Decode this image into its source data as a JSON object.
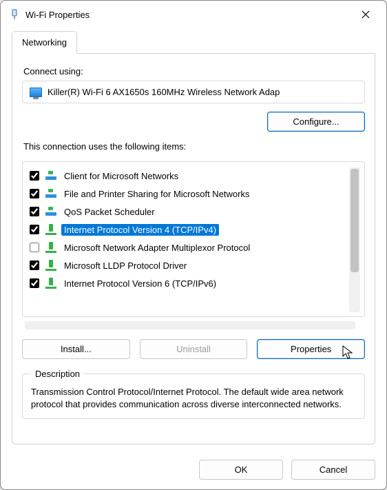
{
  "window": {
    "title": "Wi-Fi Properties"
  },
  "tabs": {
    "networking": "Networking"
  },
  "connect_label": "Connect using:",
  "adapter": "Killer(R) Wi-Fi 6 AX1650s 160MHz Wireless Network Adap",
  "configure_btn": "Configure...",
  "items_label": "This connection uses the following items:",
  "items": [
    {
      "checked": true,
      "icon": "client",
      "name": "Client for Microsoft Networks",
      "selected": false
    },
    {
      "checked": true,
      "icon": "client",
      "name": "File and Printer Sharing for Microsoft Networks",
      "selected": false
    },
    {
      "checked": true,
      "icon": "client",
      "name": "QoS Packet Scheduler",
      "selected": false
    },
    {
      "checked": true,
      "icon": "proto",
      "name": "Internet Protocol Version 4 (TCP/IPv4)",
      "selected": true
    },
    {
      "checked": false,
      "icon": "proto",
      "name": "Microsoft Network Adapter Multiplexor Protocol",
      "selected": false
    },
    {
      "checked": true,
      "icon": "proto",
      "name": "Microsoft LLDP Protocol Driver",
      "selected": false
    },
    {
      "checked": true,
      "icon": "proto",
      "name": "Internet Protocol Version 6 (TCP/IPv6)",
      "selected": false
    }
  ],
  "buttons": {
    "install": "Install...",
    "uninstall": "Uninstall",
    "properties": "Properties",
    "ok": "OK",
    "cancel": "Cancel"
  },
  "description": {
    "legend": "Description",
    "text": "Transmission Control Protocol/Internet Protocol. The default wide area network protocol that provides communication across diverse interconnected networks."
  }
}
